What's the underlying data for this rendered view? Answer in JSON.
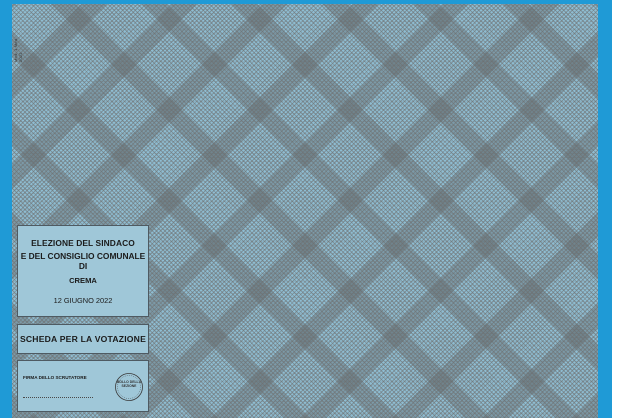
{
  "ballot": {
    "side_code": "Mod. 1 Mod. 2022",
    "election_title_line1": "ELEZIONE DEL SINDACO",
    "election_title_line2": "E DEL CONSIGLIO COMUNALE DI",
    "city": "CREMA",
    "date": "12 GIUGNO 2022",
    "scheda_label": "SCHEDA PER LA VOTAZIONE",
    "firma_label": "FIRMA DELLO SCRUTATORE",
    "stamp_text": "BOLLO DELLA SEZIONE"
  },
  "colors": {
    "frame_blue": "#1f9ad6",
    "pattern_base": "#8ebdd2",
    "box_fill": "#9fc7d8",
    "border": "#4e5a62"
  }
}
